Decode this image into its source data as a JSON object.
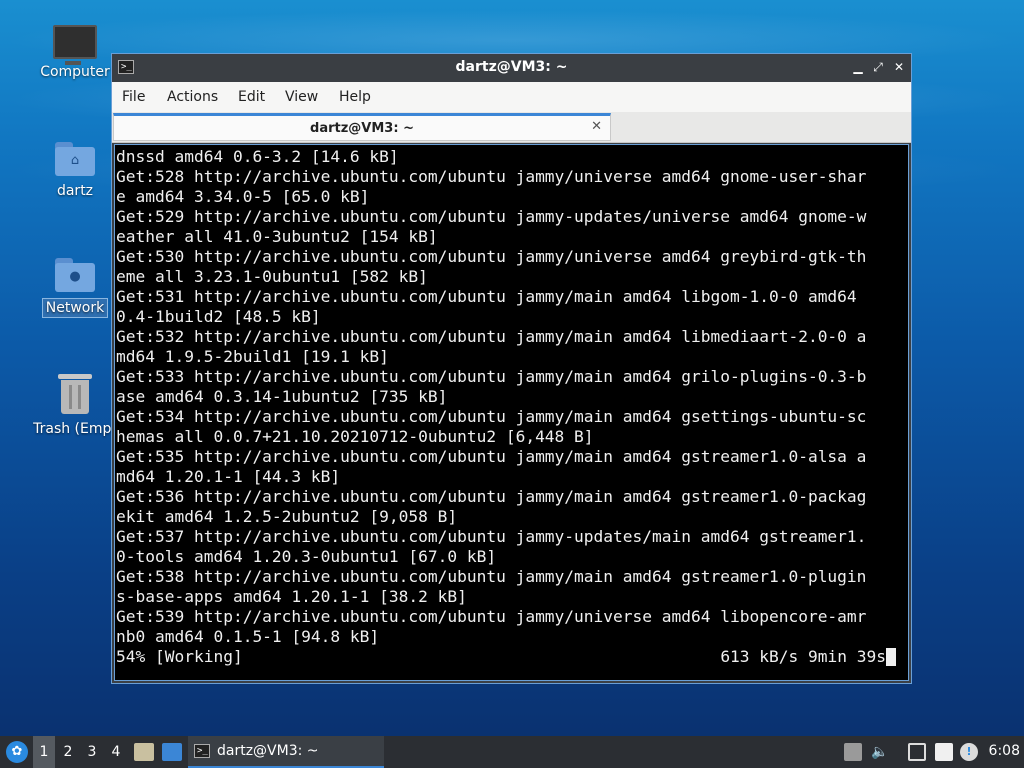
{
  "desktop": {
    "icons": [
      {
        "label": "Computer",
        "icon": "computer-icon"
      },
      {
        "label": "dartz",
        "icon": "home-folder-icon"
      },
      {
        "label": "Network",
        "icon": "network-folder-icon"
      },
      {
        "label": "Trash (Empt",
        "icon": "trash-icon"
      }
    ]
  },
  "window": {
    "title": "dartz@VM3: ~",
    "menu": [
      "File",
      "Actions",
      "Edit",
      "View",
      "Help"
    ],
    "tab": {
      "label": "dartz@VM3: ~"
    },
    "terminal": {
      "lines": [
        "dnssd amd64 0.6-3.2 [14.6 kB]",
        "Get:528 http://archive.ubuntu.com/ubuntu jammy/universe amd64 gnome-user-shar",
        "e amd64 3.34.0-5 [65.0 kB]",
        "Get:529 http://archive.ubuntu.com/ubuntu jammy-updates/universe amd64 gnome-w",
        "eather all 41.0-3ubuntu2 [154 kB]",
        "Get:530 http://archive.ubuntu.com/ubuntu jammy/universe amd64 greybird-gtk-th",
        "eme all 3.23.1-0ubuntu1 [582 kB]",
        "Get:531 http://archive.ubuntu.com/ubuntu jammy/main amd64 libgom-1.0-0 amd64",
        "0.4-1build2 [48.5 kB]",
        "Get:532 http://archive.ubuntu.com/ubuntu jammy/main amd64 libmediaart-2.0-0 a",
        "md64 1.9.5-2build1 [19.1 kB]",
        "Get:533 http://archive.ubuntu.com/ubuntu jammy/main amd64 grilo-plugins-0.3-b",
        "ase amd64 0.3.14-1ubuntu2 [735 kB]",
        "Get:534 http://archive.ubuntu.com/ubuntu jammy/main amd64 gsettings-ubuntu-sc",
        "hemas all 0.0.7+21.10.20210712-0ubuntu2 [6,448 B]",
        "Get:535 http://archive.ubuntu.com/ubuntu jammy/main amd64 gstreamer1.0-alsa a",
        "md64 1.20.1-1 [44.3 kB]",
        "Get:536 http://archive.ubuntu.com/ubuntu jammy/main amd64 gstreamer1.0-packag",
        "ekit amd64 1.2.5-2ubuntu2 [9,058 B]",
        "Get:537 http://archive.ubuntu.com/ubuntu jammy-updates/main amd64 gstreamer1.",
        "0-tools amd64 1.20.3-0ubuntu1 [67.0 kB]",
        "Get:538 http://archive.ubuntu.com/ubuntu jammy/main amd64 gstreamer1.0-plugin",
        "s-base-apps amd64 1.20.1-1 [38.2 kB]",
        "Get:539 http://archive.ubuntu.com/ubuntu jammy/universe amd64 libopencore-amr",
        "nb0 amd64 0.1.5-1 [94.8 kB]"
      ],
      "status_left": "54% [Working]",
      "status_right": "613 kB/s 9min 39s"
    }
  },
  "taskbar": {
    "workspaces": [
      "1",
      "2",
      "3",
      "4"
    ],
    "active_workspace": "1",
    "task_label": "dartz@VM3: ~",
    "clock": "6:08"
  },
  "colors": {
    "accent": "#3b86d6",
    "terminal_bg": "#000000",
    "terminal_fg": "#f0f0f0"
  }
}
